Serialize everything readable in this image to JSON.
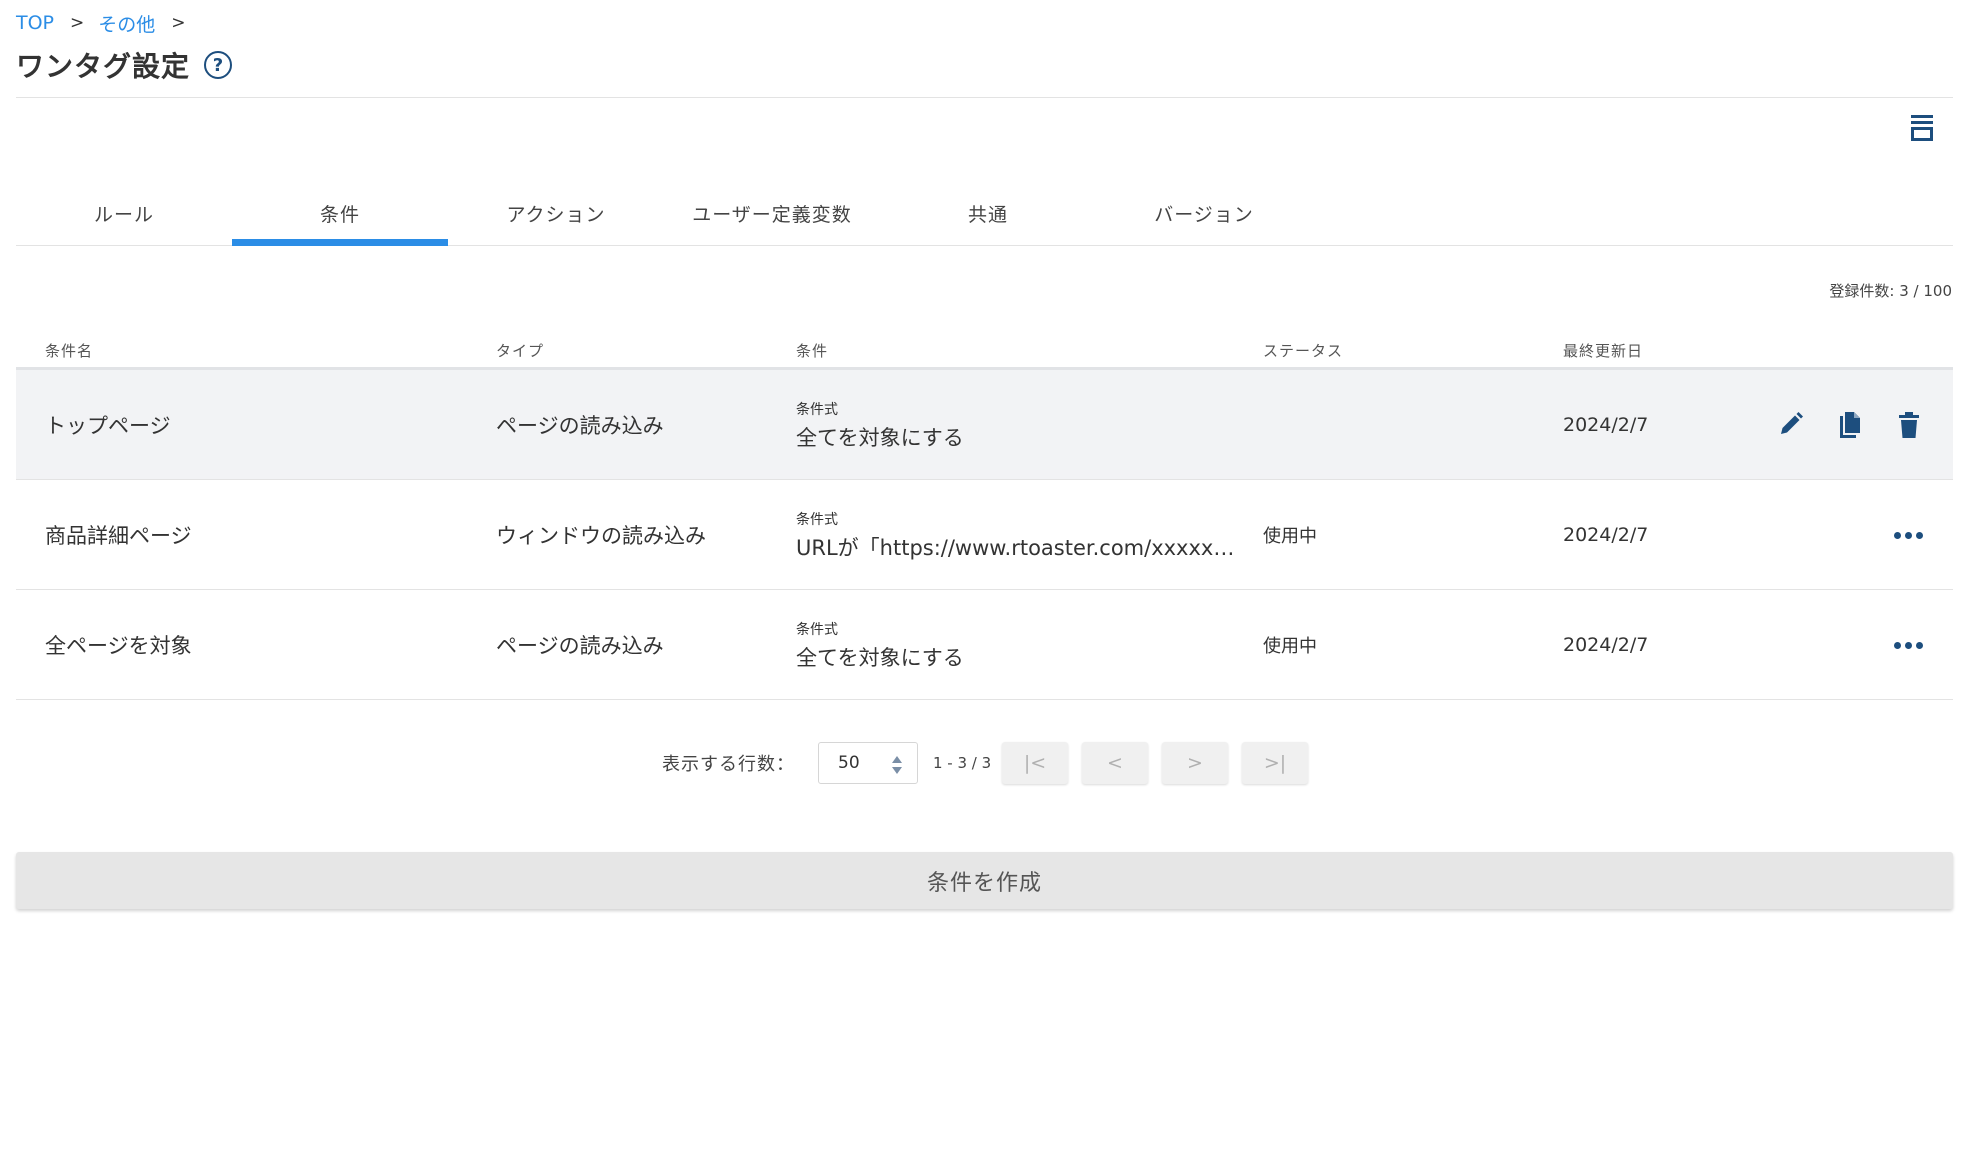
{
  "breadcrumb": {
    "items": [
      "TOP",
      "その他"
    ],
    "separator": ">"
  },
  "page": {
    "title": "ワンタグ設定",
    "help_icon": "question-circle-icon"
  },
  "tabs": [
    {
      "label": "ルール",
      "active": false
    },
    {
      "label": "条件",
      "active": true
    },
    {
      "label": "アクション",
      "active": false
    },
    {
      "label": "ユーザー定義変数",
      "active": false
    },
    {
      "label": "共通",
      "active": false
    },
    {
      "label": "バージョン",
      "active": false
    }
  ],
  "registration_count": "登録件数: 3 / 100",
  "table": {
    "headers": {
      "name": "条件名",
      "type": "タイプ",
      "condition": "条件",
      "status": "ステータス",
      "updated": "最終更新日"
    },
    "rows": [
      {
        "name": "トップページ",
        "type": "ページの読み込み",
        "condition_label": "条件式",
        "condition_value": "全てを対象にする",
        "status": "",
        "updated": "2024/2/7"
      },
      {
        "name": "商品詳細ページ",
        "type": "ウィンドウの読み込み",
        "condition_label": "条件式",
        "condition_value": "URLが「https://www.rtoaster.com/xxxxx…",
        "status": "使用中",
        "updated": "2024/2/7"
      },
      {
        "name": "全ページを対象",
        "type": "ページの読み込み",
        "condition_label": "条件式",
        "condition_value": "全てを対象にする",
        "status": "使用中",
        "updated": "2024/2/7"
      }
    ]
  },
  "pagination": {
    "rows_label": "表示する行数：",
    "rows_value": "50",
    "range": "1 - 3 / 3",
    "first": "|<",
    "prev": "<",
    "next": ">",
    "last": ">|"
  },
  "create_button": "条件を作成",
  "colors": {
    "accent": "#2b8de6",
    "icon": "#1d4e7e",
    "hover_row": "#f2f3f5"
  }
}
